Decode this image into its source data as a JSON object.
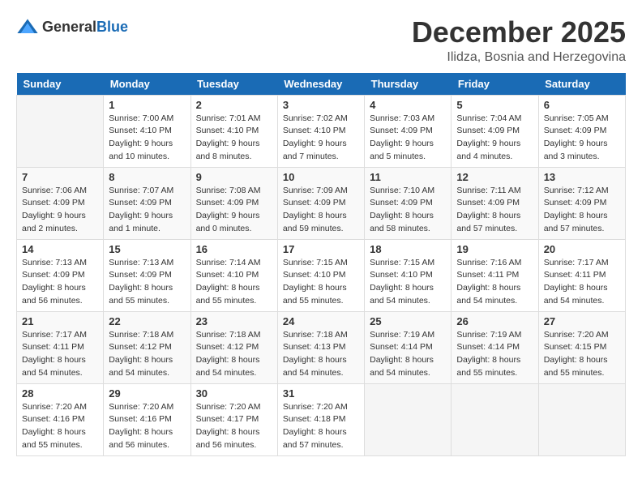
{
  "logo": {
    "general": "General",
    "blue": "Blue"
  },
  "title": "December 2025",
  "subtitle": "Ilidza, Bosnia and Herzegovina",
  "days_of_week": [
    "Sunday",
    "Monday",
    "Tuesday",
    "Wednesday",
    "Thursday",
    "Friday",
    "Saturday"
  ],
  "weeks": [
    [
      {
        "day": "",
        "info": ""
      },
      {
        "day": "1",
        "info": "Sunrise: 7:00 AM\nSunset: 4:10 PM\nDaylight: 9 hours\nand 10 minutes."
      },
      {
        "day": "2",
        "info": "Sunrise: 7:01 AM\nSunset: 4:10 PM\nDaylight: 9 hours\nand 8 minutes."
      },
      {
        "day": "3",
        "info": "Sunrise: 7:02 AM\nSunset: 4:10 PM\nDaylight: 9 hours\nand 7 minutes."
      },
      {
        "day": "4",
        "info": "Sunrise: 7:03 AM\nSunset: 4:09 PM\nDaylight: 9 hours\nand 5 minutes."
      },
      {
        "day": "5",
        "info": "Sunrise: 7:04 AM\nSunset: 4:09 PM\nDaylight: 9 hours\nand 4 minutes."
      },
      {
        "day": "6",
        "info": "Sunrise: 7:05 AM\nSunset: 4:09 PM\nDaylight: 9 hours\nand 3 minutes."
      }
    ],
    [
      {
        "day": "7",
        "info": "Sunrise: 7:06 AM\nSunset: 4:09 PM\nDaylight: 9 hours\nand 2 minutes."
      },
      {
        "day": "8",
        "info": "Sunrise: 7:07 AM\nSunset: 4:09 PM\nDaylight: 9 hours\nand 1 minute."
      },
      {
        "day": "9",
        "info": "Sunrise: 7:08 AM\nSunset: 4:09 PM\nDaylight: 9 hours\nand 0 minutes."
      },
      {
        "day": "10",
        "info": "Sunrise: 7:09 AM\nSunset: 4:09 PM\nDaylight: 8 hours\nand 59 minutes."
      },
      {
        "day": "11",
        "info": "Sunrise: 7:10 AM\nSunset: 4:09 PM\nDaylight: 8 hours\nand 58 minutes."
      },
      {
        "day": "12",
        "info": "Sunrise: 7:11 AM\nSunset: 4:09 PM\nDaylight: 8 hours\nand 57 minutes."
      },
      {
        "day": "13",
        "info": "Sunrise: 7:12 AM\nSunset: 4:09 PM\nDaylight: 8 hours\nand 57 minutes."
      }
    ],
    [
      {
        "day": "14",
        "info": "Sunrise: 7:13 AM\nSunset: 4:09 PM\nDaylight: 8 hours\nand 56 minutes."
      },
      {
        "day": "15",
        "info": "Sunrise: 7:13 AM\nSunset: 4:09 PM\nDaylight: 8 hours\nand 55 minutes."
      },
      {
        "day": "16",
        "info": "Sunrise: 7:14 AM\nSunset: 4:10 PM\nDaylight: 8 hours\nand 55 minutes."
      },
      {
        "day": "17",
        "info": "Sunrise: 7:15 AM\nSunset: 4:10 PM\nDaylight: 8 hours\nand 55 minutes."
      },
      {
        "day": "18",
        "info": "Sunrise: 7:15 AM\nSunset: 4:10 PM\nDaylight: 8 hours\nand 54 minutes."
      },
      {
        "day": "19",
        "info": "Sunrise: 7:16 AM\nSunset: 4:11 PM\nDaylight: 8 hours\nand 54 minutes."
      },
      {
        "day": "20",
        "info": "Sunrise: 7:17 AM\nSunset: 4:11 PM\nDaylight: 8 hours\nand 54 minutes."
      }
    ],
    [
      {
        "day": "21",
        "info": "Sunrise: 7:17 AM\nSunset: 4:11 PM\nDaylight: 8 hours\nand 54 minutes."
      },
      {
        "day": "22",
        "info": "Sunrise: 7:18 AM\nSunset: 4:12 PM\nDaylight: 8 hours\nand 54 minutes."
      },
      {
        "day": "23",
        "info": "Sunrise: 7:18 AM\nSunset: 4:12 PM\nDaylight: 8 hours\nand 54 minutes."
      },
      {
        "day": "24",
        "info": "Sunrise: 7:18 AM\nSunset: 4:13 PM\nDaylight: 8 hours\nand 54 minutes."
      },
      {
        "day": "25",
        "info": "Sunrise: 7:19 AM\nSunset: 4:14 PM\nDaylight: 8 hours\nand 54 minutes."
      },
      {
        "day": "26",
        "info": "Sunrise: 7:19 AM\nSunset: 4:14 PM\nDaylight: 8 hours\nand 55 minutes."
      },
      {
        "day": "27",
        "info": "Sunrise: 7:20 AM\nSunset: 4:15 PM\nDaylight: 8 hours\nand 55 minutes."
      }
    ],
    [
      {
        "day": "28",
        "info": "Sunrise: 7:20 AM\nSunset: 4:16 PM\nDaylight: 8 hours\nand 55 minutes."
      },
      {
        "day": "29",
        "info": "Sunrise: 7:20 AM\nSunset: 4:16 PM\nDaylight: 8 hours\nand 56 minutes."
      },
      {
        "day": "30",
        "info": "Sunrise: 7:20 AM\nSunset: 4:17 PM\nDaylight: 8 hours\nand 56 minutes."
      },
      {
        "day": "31",
        "info": "Sunrise: 7:20 AM\nSunset: 4:18 PM\nDaylight: 8 hours\nand 57 minutes."
      },
      {
        "day": "",
        "info": ""
      },
      {
        "day": "",
        "info": ""
      },
      {
        "day": "",
        "info": ""
      }
    ]
  ]
}
